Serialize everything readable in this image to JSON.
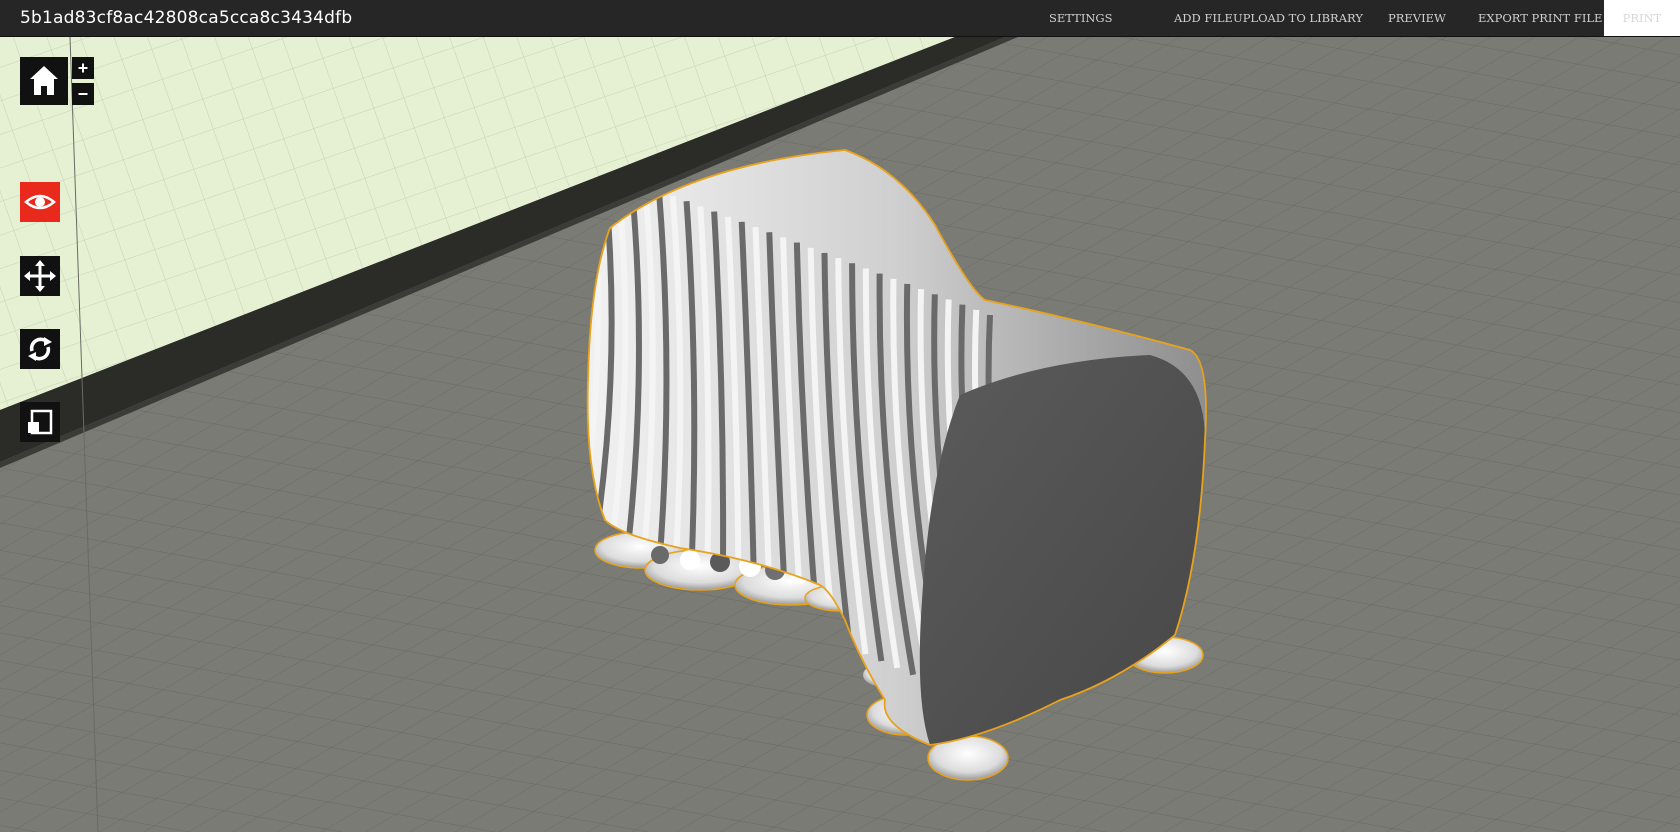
{
  "app": {
    "file_title": "5b1ad83cf8ac42808ca5cca8c3434dfb"
  },
  "menu": {
    "settings": "SETTINGS",
    "add_file": "ADD FILE",
    "upload_to_library": "UPLOAD TO LIBRARY",
    "preview": "PREVIEW",
    "export_print_file": "EXPORT PRINT FILE",
    "print": "PRINT"
  },
  "toolbar": {
    "home_icon": "home-icon",
    "zoom_in_glyph": "+",
    "zoom_out_glyph": "−",
    "view_icon": "eye-icon",
    "move_icon": "move-arrows-icon",
    "rotate_icon": "rotate-icon",
    "scale_icon": "scale-icon",
    "active_tool": "view"
  },
  "colors": {
    "topbar": "#262626",
    "active_tool": "#e8291b",
    "selection_outline": "#e8a21c",
    "build_plate": "#7a7a74",
    "back_wall": "#e6f0d2"
  }
}
